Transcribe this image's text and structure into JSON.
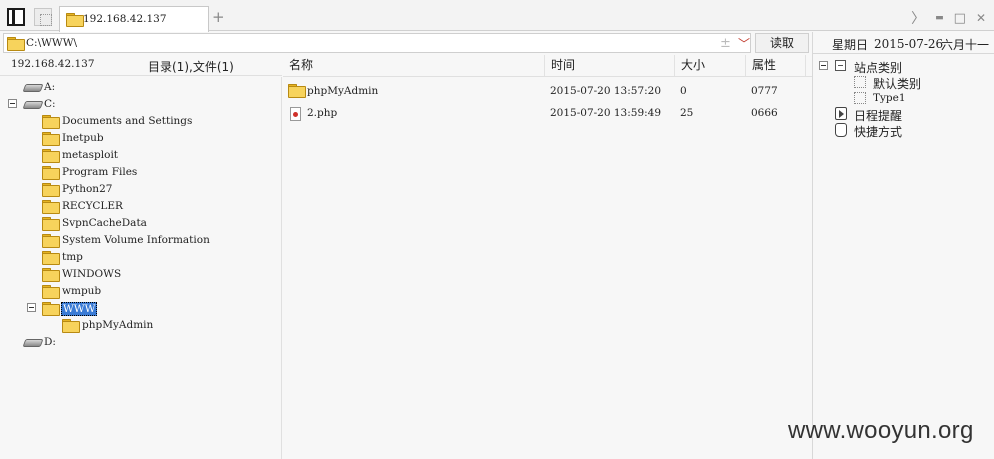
{
  "tabbar": {
    "active_tab_label": "192.168.42.137",
    "add_tab_glyph": "+",
    "controls": {
      "next": "〉",
      "minimize": "▬",
      "maximize": "□",
      "close": "✕"
    }
  },
  "address": {
    "path": "C:\\WWW\\",
    "plus_glyph": "±",
    "dropdown_glyph": "﹀",
    "read_button": "读取"
  },
  "info": {
    "host": "192.168.42.137",
    "count": "目录(1),文件(1)"
  },
  "tree": {
    "drives": [
      "A:",
      "C:",
      "D:"
    ],
    "c_children": [
      "Documents and Settings",
      "Inetpub",
      "metasploit",
      "Program Files",
      "Python27",
      "RECYCLER",
      "SvpnCacheData",
      "System Volume Information",
      "tmp",
      "WINDOWS",
      "wmpub",
      "WWW"
    ],
    "www_child": "phpMyAdmin"
  },
  "filelist": {
    "headers": {
      "name": "名称",
      "time": "时间",
      "size": "大小",
      "attr": "属性"
    },
    "rows": [
      {
        "name": "phpMyAdmin",
        "time": "2015-07-20 13:57:20",
        "size": "0",
        "attr": "0777",
        "type": "folder"
      },
      {
        "name": "2.php",
        "time": "2015-07-20 13:59:49",
        "size": "25",
        "attr": "0666",
        "type": "php"
      }
    ]
  },
  "rightpanel": {
    "weekday": "星期日",
    "date": "2015-07-26",
    "lunar": "六月十一",
    "site_category": "站点类别",
    "default_category": "默认类别",
    "type1": "Type1",
    "schedule": "日程提醒",
    "shortcut": "快捷方式"
  },
  "watermark": "www.wooyun.org"
}
